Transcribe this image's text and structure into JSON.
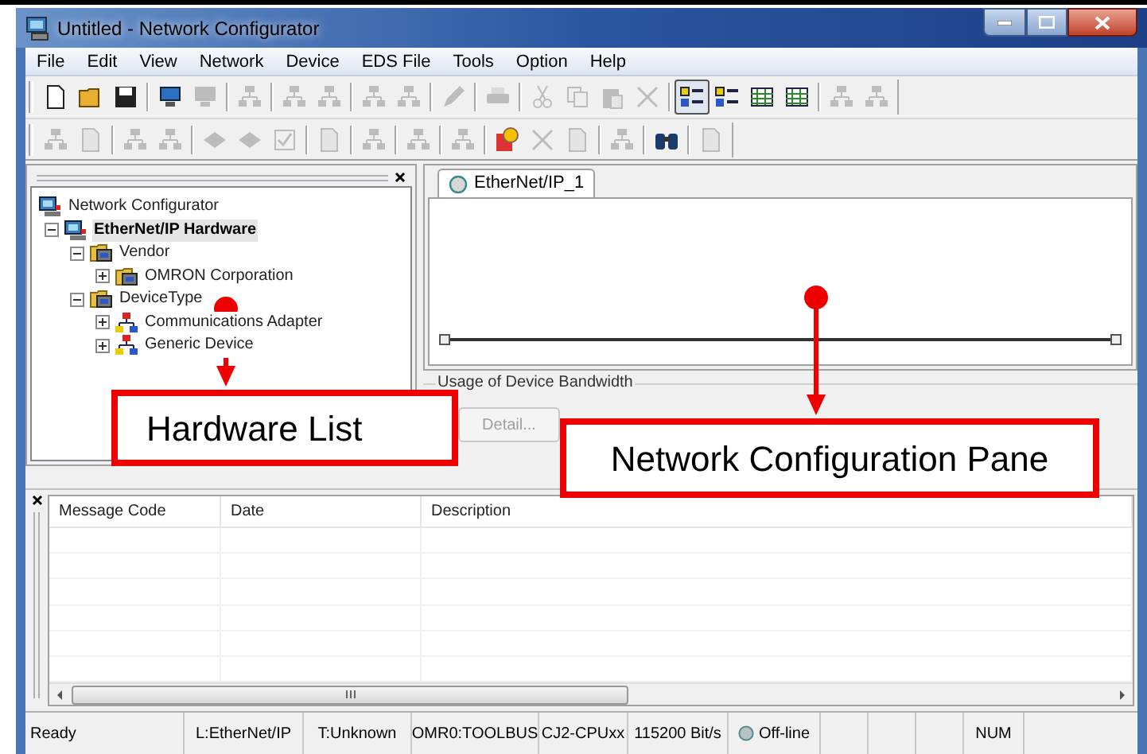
{
  "window": {
    "title": "Untitled - Network Configurator"
  },
  "menu": [
    "File",
    "Edit",
    "View",
    "Network",
    "Device",
    "EDS File",
    "Tools",
    "Option",
    "Help"
  ],
  "toolbars": [
    {
      "groups": [
        [
          {
            "disabled": false,
            "selected": false
          },
          {
            "disabled": false,
            "selected": false
          },
          {
            "disabled": false,
            "selected": false
          }
        ],
        [
          {
            "disabled": false,
            "selected": false
          },
          {
            "disabled": true,
            "selected": false
          }
        ],
        [
          {
            "disabled": true,
            "selected": false
          }
        ],
        [
          {
            "disabled": true,
            "selected": false
          },
          {
            "disabled": true,
            "selected": false
          }
        ],
        [
          {
            "disabled": true,
            "selected": false
          },
          {
            "disabled": true,
            "selected": false
          }
        ],
        [
          {
            "disabled": true,
            "selected": false
          }
        ],
        [
          {
            "disabled": true,
            "selected": false
          }
        ],
        [
          {
            "disabled": true,
            "selected": false
          },
          {
            "disabled": true,
            "selected": false
          },
          {
            "disabled": true,
            "selected": false
          },
          {
            "disabled": true,
            "selected": false
          }
        ],
        [
          {
            "disabled": false,
            "selected": true
          },
          {
            "disabled": false,
            "selected": false
          },
          {
            "disabled": false,
            "selected": false
          },
          {
            "disabled": false,
            "selected": false
          }
        ],
        [
          {
            "disabled": true,
            "selected": false
          },
          {
            "disabled": true,
            "selected": false
          }
        ]
      ]
    },
    {
      "groups": [
        [
          {
            "disabled": true,
            "selected": false
          },
          {
            "disabled": true,
            "selected": false
          }
        ],
        [
          {
            "disabled": true,
            "selected": false
          },
          {
            "disabled": true,
            "selected": false
          }
        ],
        [
          {
            "disabled": true,
            "selected": false
          },
          {
            "disabled": true,
            "selected": false
          },
          {
            "disabled": true,
            "selected": false
          }
        ],
        [
          {
            "disabled": true,
            "selected": false
          }
        ],
        [
          {
            "disabled": true,
            "selected": false
          }
        ],
        [
          {
            "disabled": true,
            "selected": false
          }
        ],
        [
          {
            "disabled": true,
            "selected": false
          }
        ],
        [
          {
            "disabled": false,
            "selected": false
          },
          {
            "disabled": true,
            "selected": false
          },
          {
            "disabled": true,
            "selected": false
          }
        ],
        [
          {
            "disabled": true,
            "selected": false
          }
        ],
        [
          {
            "disabled": false,
            "selected": false
          }
        ],
        [
          {
            "disabled": true,
            "selected": false
          }
        ]
      ]
    }
  ],
  "hardware_tree": [
    {
      "label": "Network Configurator",
      "kind": "computer",
      "selected": false,
      "children": [
        {
          "label": "EtherNet/IP Hardware",
          "kind": "computer",
          "selected": true,
          "expanded": true,
          "children": [
            {
              "label": "Vendor",
              "kind": "folder",
              "selected": false,
              "expanded": true,
              "children": [
                {
                  "label": "OMRON Corporation",
                  "kind": "folder",
                  "selected": false,
                  "expanded": false
                }
              ]
            },
            {
              "label": "DeviceType",
              "kind": "folder",
              "selected": false,
              "expanded": true,
              "children": [
                {
                  "label": "Communications Adapter",
                  "kind": "network",
                  "selected": false,
                  "expanded": false
                },
                {
                  "label": "Generic Device",
                  "kind": "network",
                  "selected": false,
                  "expanded": false
                }
              ]
            }
          ]
        }
      ]
    }
  ],
  "network_tabs": [
    {
      "label": "EtherNet/IP_1",
      "selected": true
    }
  ],
  "bandwidth": {
    "label": "Usage of Device Bandwidth",
    "button": {
      "label": "Detail...",
      "disabled": true
    }
  },
  "message_table": {
    "columns": [
      "Message Code",
      "Date",
      "Description"
    ]
  },
  "status_bar": [
    {
      "text": "Ready",
      "kind": "text"
    },
    {
      "text": "L:EtherNet/IP",
      "kind": "text"
    },
    {
      "text": "T:Unknown",
      "kind": "text"
    },
    {
      "text": "OMR0:TOOLBUS",
      "kind": "text"
    },
    {
      "text": "CJ2-CPUxx",
      "kind": "text"
    },
    {
      "text": "115200 Bit/s",
      "kind": "text"
    },
    {
      "text": "Off-line",
      "kind": "indicator"
    },
    {
      "text": "NUM",
      "kind": "text"
    }
  ],
  "callouts": [
    {
      "label": "Hardware List"
    },
    {
      "label": "Network Configuration Pane"
    }
  ]
}
